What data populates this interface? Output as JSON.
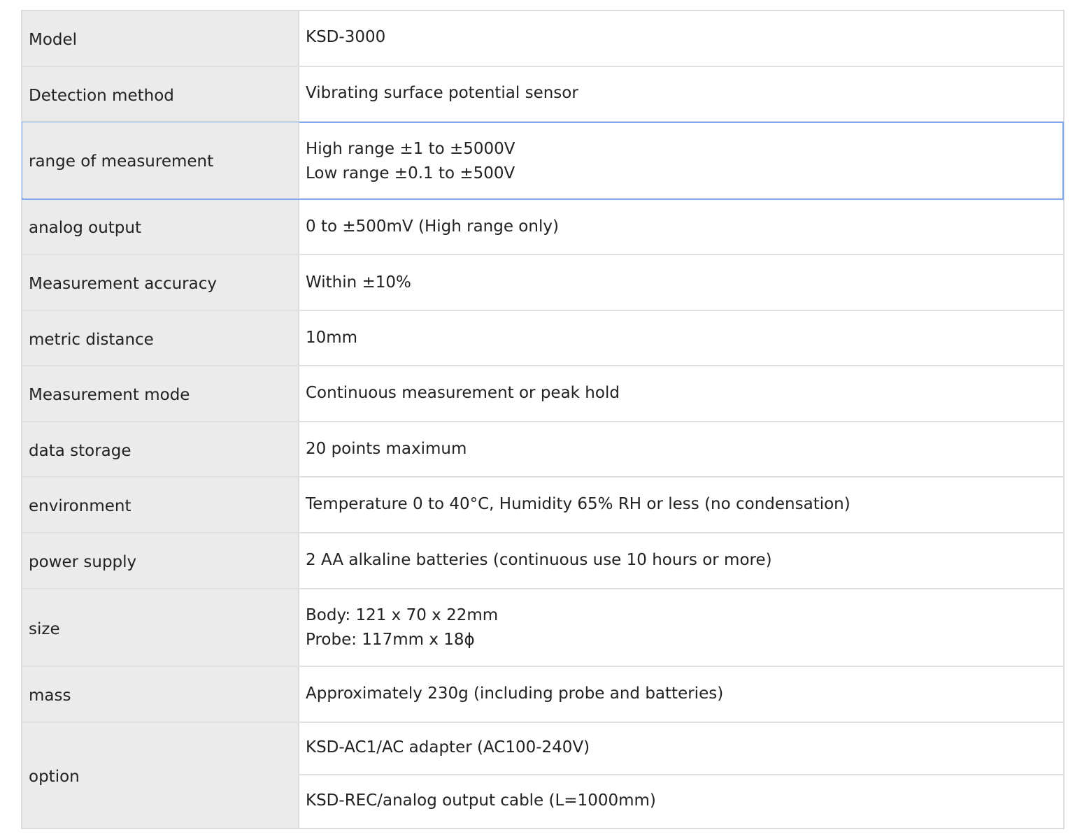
{
  "specs": [
    {
      "label": "Model",
      "lines": [
        "KSD-3000"
      ]
    },
    {
      "label": "Detection method",
      "lines": [
        "Vibrating surface potential sensor"
      ]
    },
    {
      "label": "range of measurement",
      "lines": [
        "High range ±1 to ±5000V",
        "Low range ±0.1 to ±500V"
      ]
    },
    {
      "label": "analog output",
      "lines": [
        "0 to ±500mV (High range only)"
      ]
    },
    {
      "label": "Measurement accuracy",
      "lines": [
        "Within ±10%"
      ]
    },
    {
      "label": "metric distance",
      "lines": [
        "10mm"
      ]
    },
    {
      "label": "Measurement mode",
      "lines": [
        "Continuous measurement or peak hold"
      ]
    },
    {
      "label": "data storage",
      "lines": [
        "20 points maximum"
      ]
    },
    {
      "label": "environment",
      "lines": [
        "Temperature 0 to 40°C, Humidity 65% RH or less (no condensation)"
      ]
    },
    {
      "label": "power supply",
      "lines": [
        "2 AA alkaline batteries (continuous use 10 hours or more)"
      ]
    },
    {
      "label": "size",
      "lines": [
        "Body: 121 x 70 x 22mm",
        "Probe: 117mm x 18ϕ"
      ]
    },
    {
      "label": "mass",
      "lines": [
        "Approximately 230g (including probe and batteries)"
      ]
    }
  ],
  "option": {
    "label": "option",
    "items": [
      "KSD-AC1/AC adapter (AC100-240V)",
      "KSD-REC/analog output cable (L=1000mm)"
    ]
  }
}
